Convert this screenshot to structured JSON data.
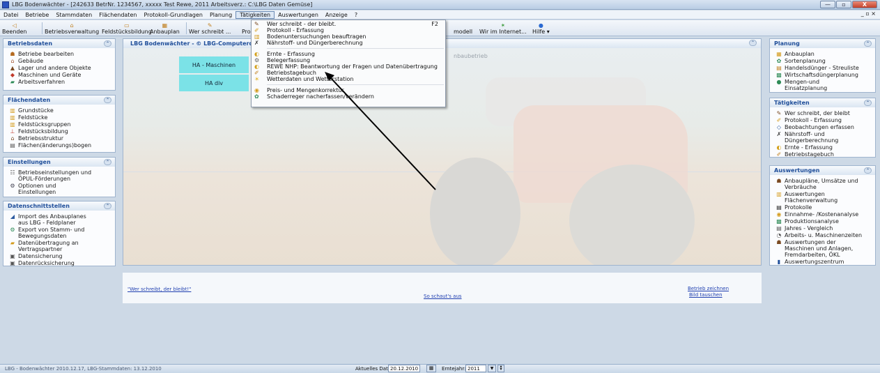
{
  "window": {
    "title": "LBG Bodenwächter - [242633  BetrNr. 1234567, xxxxx Test Rewe, 2011  Arbeitsverz.: C:\\LBG Daten Gemüse]",
    "buttons": [
      "—",
      "▫",
      "X"
    ]
  },
  "menubar": {
    "items": [
      "Datei",
      "Betriebe",
      "Stammdaten",
      "Flächendaten",
      "Protokoll-Grundlagen",
      "Planung",
      "Tätigkeiten",
      "Auswertungen",
      "Anzeige",
      "?"
    ],
    "mdi_controls": "_ ▫ ×"
  },
  "toolbar": {
    "buttons": [
      "Beenden",
      "Betriebsverwaltung",
      "Feldstücksbildung",
      "Anbauplan",
      "Wer schreibt ...",
      "Pro",
      "modell",
      "Wir im Internet...",
      "Hilfe ▾"
    ]
  },
  "left_panels": [
    {
      "title": "Betriebsdaten",
      "items": [
        {
          "label": "Betriebe bearbeiten",
          "icon": "farmer-icon"
        },
        {
          "label": "Gebäude",
          "icon": "building-icon"
        },
        {
          "label": "Lager und andere Objekte",
          "icon": "storage-icon"
        },
        {
          "label": "Maschinen und Geräte",
          "icon": "tractor-icon"
        },
        {
          "label": "Arbeitsverfahren",
          "icon": "process-icon"
        }
      ]
    },
    {
      "title": "Flächendaten",
      "items": [
        {
          "label": "Grundstücke",
          "icon": "parcel-icon"
        },
        {
          "label": "Feldstücke",
          "icon": "field-icon"
        },
        {
          "label": "Feldstücksgruppen",
          "icon": "field-group-icon"
        },
        {
          "label": "Feldstücksbildung",
          "icon": "field-build-icon"
        },
        {
          "label": "Betriebsstruktur",
          "icon": "structure-icon"
        },
        {
          "label": "Flächen(änderungs)bogen",
          "icon": "sheet-icon"
        }
      ]
    },
    {
      "title": "Einstellungen",
      "items": [
        {
          "label": "Betriebseinstellungen und\nÖPUL-Förderungen",
          "icon": "settings-icon"
        },
        {
          "label": "Optionen und\nEinstellungen",
          "icon": "options-icon"
        }
      ]
    },
    {
      "title": "Datenschnittstellen",
      "items": [
        {
          "label": "Import des Anbauplanes\naus LBG - Feldplaner",
          "icon": "import-icon"
        },
        {
          "label": "Export von Stamm- und\nBewegungsdaten",
          "icon": "export-icon"
        },
        {
          "label": "Datenübertragung an\nVertragspartner",
          "icon": "transfer-icon"
        },
        {
          "label": "Datensicherung",
          "icon": "backup-icon"
        },
        {
          "label": "Datenrücksicherung",
          "icon": "restore-icon"
        }
      ]
    }
  ],
  "right_panels": [
    {
      "title": "Planung",
      "items": [
        {
          "label": "Anbauplan",
          "icon": "plan-icon"
        },
        {
          "label": "Sortenplanung",
          "icon": "variety-icon"
        },
        {
          "label": "Handelsdünger - Streuliste",
          "icon": "fertilizer-icon"
        },
        {
          "label": "Wirtschaftsdüngerplanung",
          "icon": "manure-icon"
        },
        {
          "label": "Mengen-und\nEinsatzplanung",
          "icon": "quantity-icon"
        }
      ]
    },
    {
      "title": "Tätigkeiten",
      "items": [
        {
          "label": "Wer schreibt, der bleibt",
          "icon": "write-icon"
        },
        {
          "label": "Protokoll - Erfassung",
          "icon": "protocol-icon"
        },
        {
          "label": "Beobachtungen erfassen",
          "icon": "observe-icon"
        },
        {
          "label": "Nährstoff- und\nDüngerberechnung",
          "icon": "nutrient-icon"
        },
        {
          "label": "Ernte - Erfassung",
          "icon": "harvest-icon"
        },
        {
          "label": "Betriebstagebuch",
          "icon": "diary-icon"
        }
      ]
    },
    {
      "title": "Auswertungen",
      "items": [
        {
          "label": "Anbaupläne, Umsätze und\nVerbräuche",
          "icon": "report-icon"
        },
        {
          "label": "Auswertungen\nFlächenverwaltung",
          "icon": "area-report-icon"
        },
        {
          "label": "Protokolle",
          "icon": "protocols-icon"
        },
        {
          "label": "Einnahme- /Kostenanalyse",
          "icon": "cost-icon"
        },
        {
          "label": "Produktionsanalyse",
          "icon": "production-icon"
        },
        {
          "label": "Jahres - Vergleich",
          "icon": "year-compare-icon"
        },
        {
          "label": "Arbeits- u. Maschinenzeiten",
          "icon": "worktime-icon"
        },
        {
          "label": "Auswertungen der\nMaschinen und Anlagen,\nFremdarbeiten, ÖKL",
          "icon": "machine-report-icon"
        },
        {
          "label": "Auswertungszentrum",
          "icon": "report-center-icon"
        }
      ]
    }
  ],
  "center": {
    "title": "LBG Bodenwächter - © LBG-Computerdi",
    "subtitle": "nbaubetrieb",
    "box1": "HA - Maschinen",
    "box2": "HA div"
  },
  "dropdown": {
    "items": [
      {
        "label": "Wer schreibt - der bleibt.",
        "shortcut": "F2",
        "icon": "write-icon"
      },
      {
        "label": "Protokoll - Erfassung",
        "shortcut": "",
        "icon": "protocol-icon"
      },
      {
        "label": "Bodenuntersuchungen beauftragen",
        "shortcut": "",
        "icon": "soil-icon"
      },
      {
        "label": "Nährstoff- und Düngerberechnung",
        "shortcut": "",
        "icon": "nutrient-icon"
      },
      {
        "sep": true
      },
      {
        "label": "Ernte - Erfassung",
        "shortcut": "",
        "icon": "harvest-icon"
      },
      {
        "label": "Belegerfassung",
        "shortcut": "",
        "icon": "receipt-icon"
      },
      {
        "label": "REWE NHP: Beantwortung der Fragen und Datenübertragung",
        "shortcut": "",
        "icon": "rewe-icon"
      },
      {
        "label": "Betriebstagebuch",
        "shortcut": "",
        "icon": "diary-icon"
      },
      {
        "label": "Wetterdaten und Wetterstation",
        "shortcut": "",
        "icon": "weather-icon"
      },
      {
        "sep": true
      },
      {
        "label": "Preis- und Mengenkorrektur",
        "shortcut": "",
        "icon": "price-icon"
      },
      {
        "label": "Schaderreger nacherfassen/verändern",
        "shortcut": "",
        "icon": "pest-icon"
      }
    ]
  },
  "footer": {
    "link_left": "\"Wer schreibt, der bleibt!\"",
    "link_center": "So schaut's aus",
    "link_right1": "Betrieb zeichnen",
    "link_right2": "Bild tauschen"
  },
  "status": {
    "left": "LBG - Bodenwächter 2010.12.17, LBG-Stammdaten: 13.12.2010",
    "date_label": "Aktuelles Datum:",
    "date": "20.12.2010",
    "year_label": "Erntejahr:",
    "year": "2011"
  },
  "colors": {
    "accent": "#1f4e9a",
    "cyan_box": "#7be2e7",
    "link": "#1f3fb0"
  }
}
